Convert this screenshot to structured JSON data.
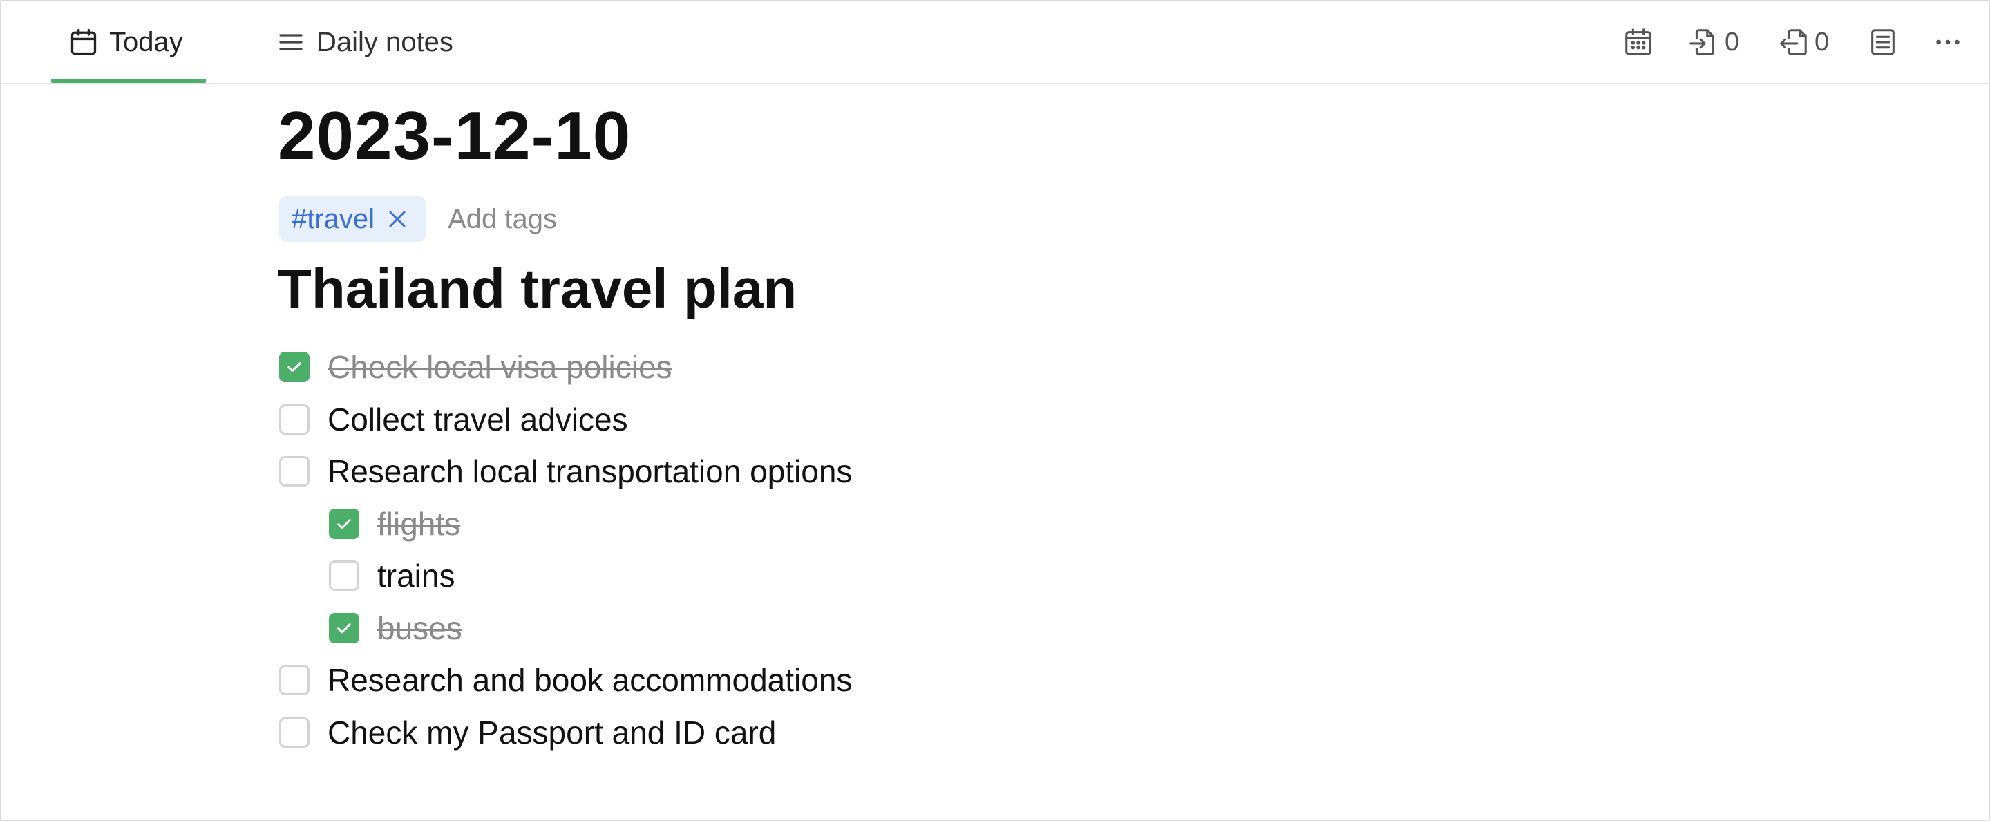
{
  "header": {
    "tabs": [
      {
        "label": "Today",
        "icon": "calendar-icon",
        "active": true
      },
      {
        "label": "Daily notes",
        "icon": "list-icon",
        "active": false
      }
    ],
    "tools": {
      "calendar": {
        "icon": "calendar-grid-icon"
      },
      "incoming_links": {
        "icon": "incoming-link-icon",
        "count": "0"
      },
      "outgoing_links": {
        "icon": "outgoing-link-icon",
        "count": "0"
      },
      "outline": {
        "icon": "outline-icon"
      },
      "more": {
        "icon": "more-icon"
      }
    },
    "accent_color": "#4caf69"
  },
  "page": {
    "date_title": "2023-12-10",
    "tags": [
      {
        "label": "#travel"
      }
    ],
    "add_tags_placeholder": "Add tags",
    "section_title": "Thailand travel plan",
    "todos": [
      {
        "text": "Check local visa policies",
        "checked": true,
        "level": 0
      },
      {
        "text": "Collect travel advices",
        "checked": false,
        "level": 0
      },
      {
        "text": "Research local transportation options",
        "checked": false,
        "level": 0
      },
      {
        "text": "flights",
        "checked": true,
        "level": 1
      },
      {
        "text": "trains",
        "checked": false,
        "level": 1
      },
      {
        "text": "buses",
        "checked": true,
        "level": 1
      },
      {
        "text": "Research and book accommodations",
        "checked": false,
        "level": 0
      },
      {
        "text": "Check my Passport and ID card",
        "checked": false,
        "level": 0
      }
    ],
    "tag_color": "#3a6fd8",
    "checked_color": "#4caf69"
  }
}
